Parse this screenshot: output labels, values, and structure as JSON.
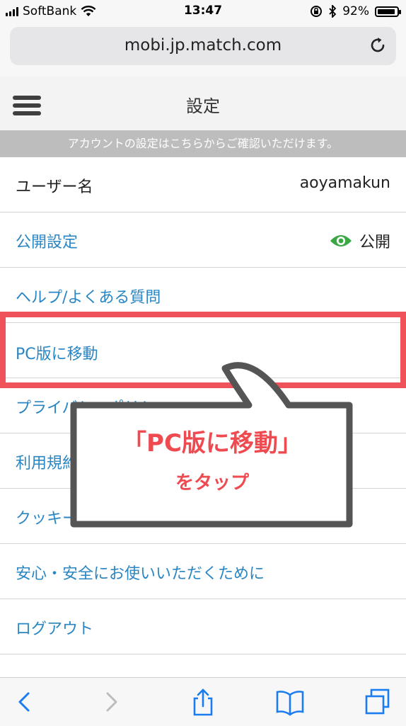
{
  "status_bar": {
    "carrier": "SoftBank",
    "time": "13:47",
    "battery": "92%",
    "battery_level": 0.92
  },
  "browser": {
    "url": "mobi.jp.match.com"
  },
  "header": {
    "title": "設定"
  },
  "notice": "アカウントの設定はこちらからご確認いただけます。",
  "settings": {
    "username": {
      "label": "ユーザー名",
      "value": "aoyamakun"
    },
    "visibility": {
      "label": "公開設定",
      "value": "公開"
    },
    "help": {
      "label": "ヘルプ/よくある質問"
    },
    "pc_version": {
      "label": "PC版に移動"
    },
    "privacy": {
      "label": "プライバシーポリシー"
    },
    "terms": {
      "label": "利用規約"
    },
    "cookie": {
      "label": "クッキーポリシー"
    },
    "safety": {
      "label": "安心・安全にお使いいただくために"
    },
    "logout": {
      "label": "ログアウト"
    }
  },
  "callout": {
    "line1": "「PC版に移動」",
    "line2": "をタップ"
  },
  "colors": {
    "link": "#2a86c2",
    "highlight": "#f0525a",
    "eye": "#3aa944",
    "ios_blue": "#1a7cf0"
  },
  "toolbar": {
    "icons": [
      "back-icon",
      "forward-icon",
      "share-icon",
      "bookmarks-icon",
      "tabs-icon"
    ]
  }
}
